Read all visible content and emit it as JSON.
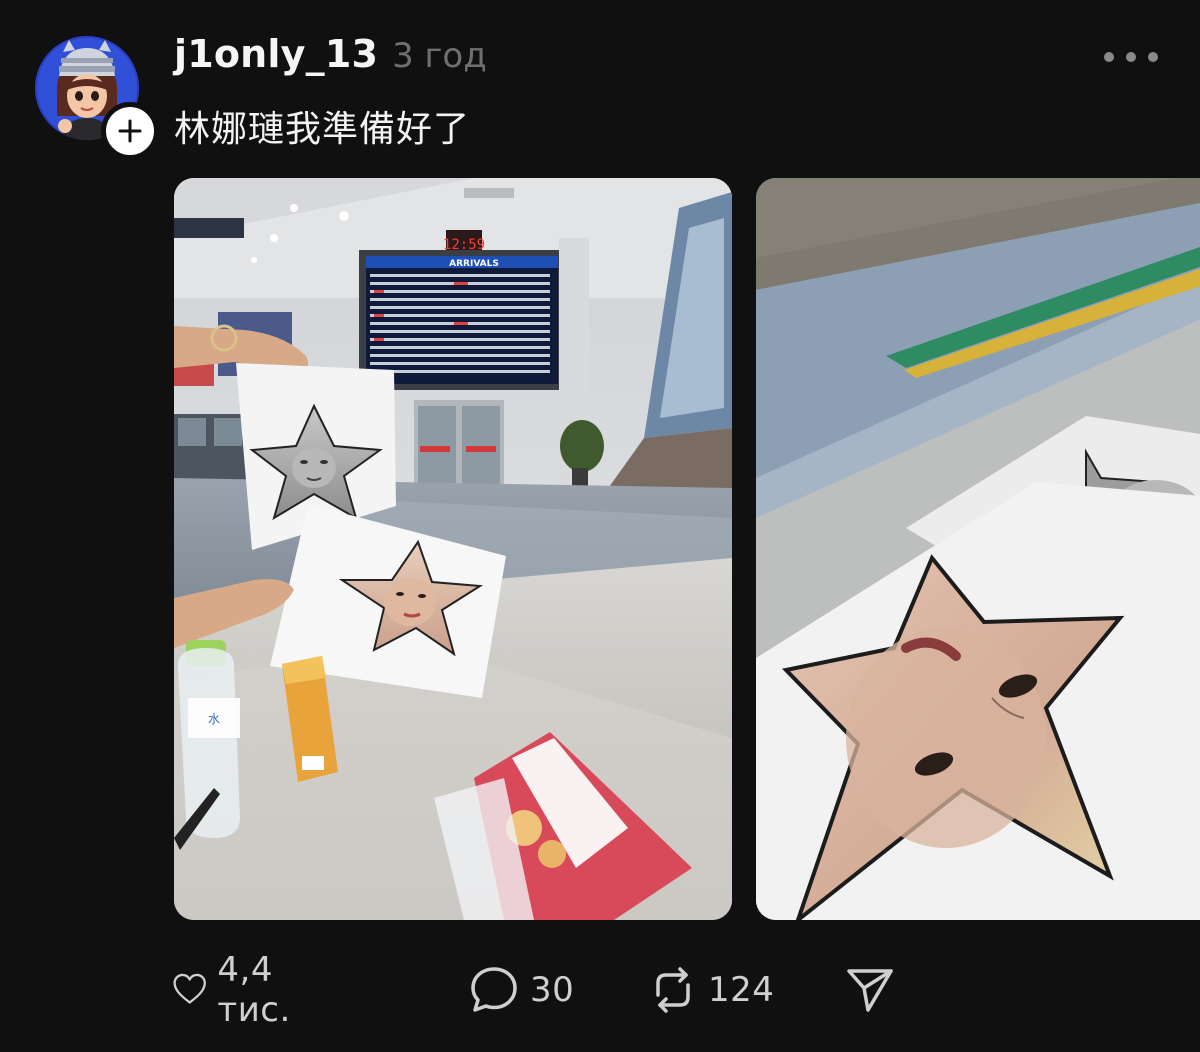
{
  "post": {
    "username": "j1only_13",
    "timestamp": "3 год",
    "caption": "林娜璉我準備好了"
  },
  "actions": {
    "likes": "4,4 тис.",
    "comments": "30",
    "reposts": "124"
  },
  "photos": {
    "photo1": {
      "board_header": "ARRIVALS",
      "board_clock": "12:59"
    }
  },
  "icons": {
    "follow": "plus-icon",
    "more": "more-dots-icon",
    "like": "heart-icon",
    "comment": "comment-bubble-icon",
    "repost": "repost-icon",
    "share": "send-icon"
  },
  "colors": {
    "background": "#101010",
    "text_primary": "#f3f3f3",
    "text_secondary": "#6f6f6f",
    "icon": "#cfcfcf"
  }
}
